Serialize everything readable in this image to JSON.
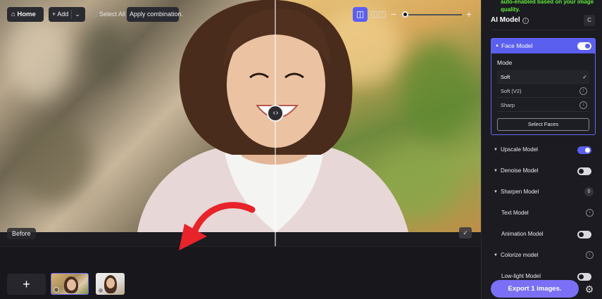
{
  "canvas": {
    "before_label": "Before"
  },
  "toolbar": {
    "home_label": "Home",
    "add_label": "+ Add",
    "add_dropdown_icon": "chevron-down-icon",
    "select_all_label": "Select All",
    "apply_label": "Apply combination.",
    "zoom_minus": "−",
    "zoom_plus": "+"
  },
  "thumbnails": {
    "add_image": "+"
  },
  "panel": {
    "note": "auto-enabled based on your image quality.",
    "title": "AI Model",
    "reset_label": "C",
    "face_model": {
      "label": "Face Model",
      "enabled": true,
      "mode_label": "Mode",
      "modes": [
        "Soft",
        "Soft (V2)",
        "Sharp"
      ],
      "selected_mode": "Soft",
      "select_faces_label": "Select Faces"
    },
    "models": {
      "upscale": "Upscale Model",
      "denoise": "Denoise Model",
      "sharpen": "Sharpen Model",
      "sharpen_badge": "0",
      "text": "Text Model",
      "animation": "Animation Model",
      "colorize": "Colorize model",
      "lowlight": "Low-light Model"
    },
    "toggles": {
      "upscale": true,
      "denoise": false,
      "animation": false,
      "lowlight": false
    },
    "export_label": "Export 1 images."
  },
  "colors": {
    "accent": "#5b5ff0",
    "export": "#7a6ff5",
    "note_green": "#62ed3a",
    "arrow_red": "#e8232a"
  }
}
